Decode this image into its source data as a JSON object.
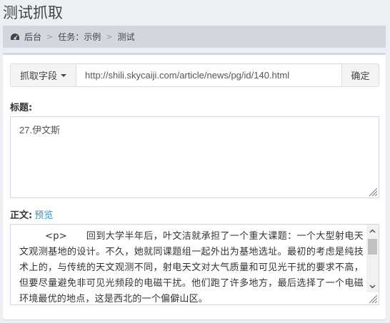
{
  "page": {
    "title": "测试抓取"
  },
  "breadcrumb": {
    "home": "后台",
    "task": "任务：示例",
    "current": "测试"
  },
  "url_bar": {
    "field_button": "抓取字段",
    "url_value": "http://shili.skycaiji.com/article/news/pg/id/140.html",
    "confirm_button": "确定"
  },
  "fields": {
    "title_label": "标题:",
    "title_value": "27.伊文斯",
    "body_label": "正文:",
    "preview_link": "预览",
    "body_value": "        <p>      回到大学半年后，叶文洁就承担了一个重大课题：一个大型射电天文观测基地的设计。不久，她就同课题组一起外出为基地选址。最初的考虑是纯技术上的，与传统的天文观测不同，射电天文对大气质量和可见光干扰的要求不高，但要尽量避免非可见光频段的电磁干扰。他们跑了许多地方，最后选择了一个电磁环境最优的地点，这是西北的一个偏僻山区。"
  }
}
